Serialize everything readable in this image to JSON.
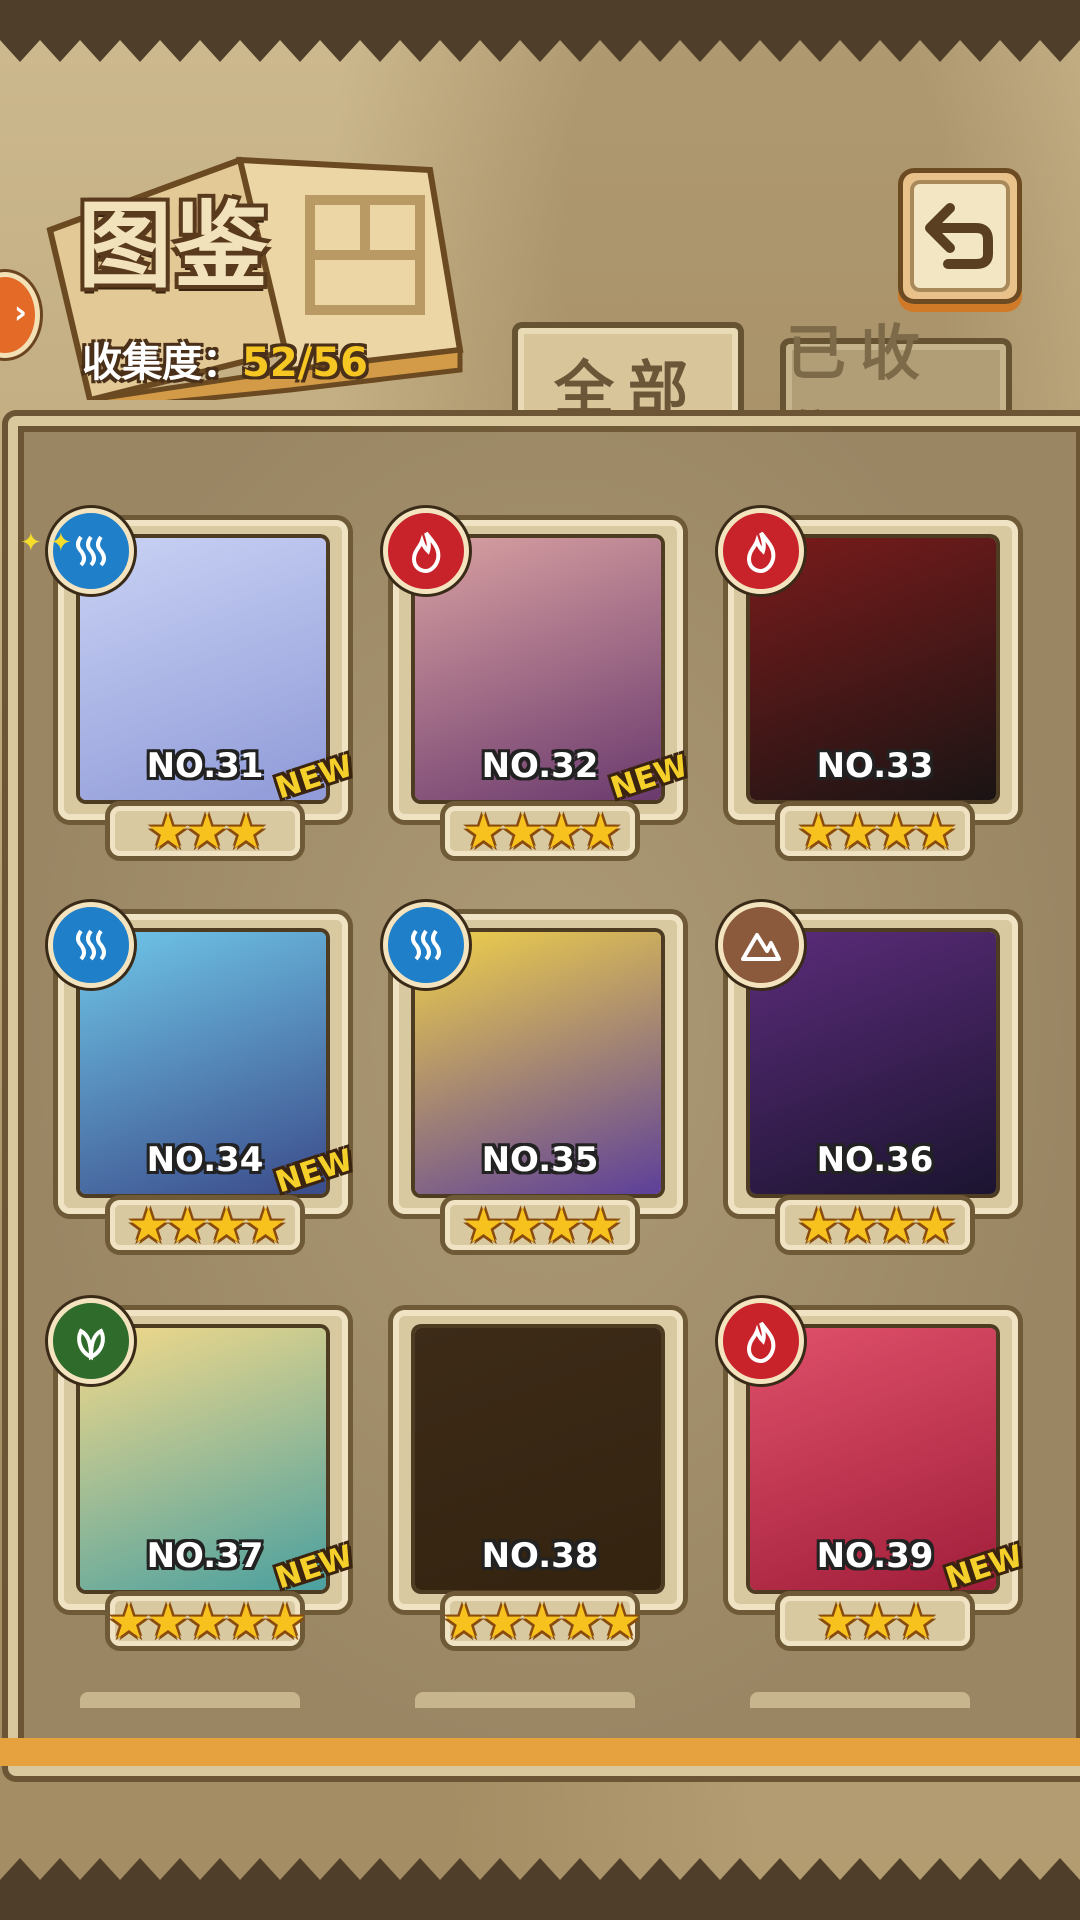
{
  "header": {
    "title": "图鉴",
    "collection_label": "收集度：",
    "collection_value": "52/56"
  },
  "tabs": [
    {
      "label": "全部",
      "active": true
    },
    {
      "label": "已收集",
      "active": false
    }
  ],
  "cards": [
    {
      "number": "NO.31",
      "stars": "★★★",
      "element": "water-icon",
      "is_new": true,
      "new_label": "NEW",
      "portrait_colors": [
        "#c9d2f4",
        "#8f9ad8"
      ]
    },
    {
      "number": "NO.32",
      "stars": "★★★★",
      "element": "fire-icon",
      "is_new": true,
      "new_label": "NEW",
      "portrait_colors": [
        "#d9a1a1",
        "#6a3a6e"
      ]
    },
    {
      "number": "NO.33",
      "stars": "★★★★",
      "element": "fire-icon",
      "is_new": false,
      "new_label": "",
      "portrait_colors": [
        "#7a1b1b",
        "#1a1414"
      ]
    },
    {
      "number": "NO.34",
      "stars": "★★★★",
      "element": "water-icon",
      "is_new": true,
      "new_label": "NEW",
      "portrait_colors": [
        "#6fc6e8",
        "#3b4b8a"
      ]
    },
    {
      "number": "NO.35",
      "stars": "★★★★",
      "element": "water-icon",
      "is_new": false,
      "new_label": "",
      "portrait_colors": [
        "#f0d14a",
        "#5d3f9a"
      ]
    },
    {
      "number": "NO.36",
      "stars": "★★★★",
      "element": "earth-icon",
      "is_new": false,
      "new_label": "",
      "portrait_colors": [
        "#5b2c7a",
        "#1b1430"
      ]
    },
    {
      "number": "NO.37",
      "stars": "★★★★★",
      "element": "wood-icon",
      "is_new": true,
      "new_label": "NEW",
      "portrait_colors": [
        "#f3d98a",
        "#4aa0a0"
      ]
    },
    {
      "number": "NO.38",
      "stars": "★★★★★",
      "element": "",
      "is_new": false,
      "new_label": "",
      "portrait_colors": [
        "#3d2b18",
        "#33230f"
      ]
    },
    {
      "number": "NO.39",
      "stars": "★★★",
      "element": "fire-icon",
      "is_new": true,
      "new_label": "NEW",
      "portrait_colors": [
        "#e0506a",
        "#a01e3a"
      ]
    }
  ],
  "colors": {
    "water": "#1f7fc9",
    "fire": "#c8232a",
    "earth": "#8b5a3c",
    "wood": "#2f6b2a",
    "star": "#f8c21e",
    "accent": "#e5a23e"
  }
}
